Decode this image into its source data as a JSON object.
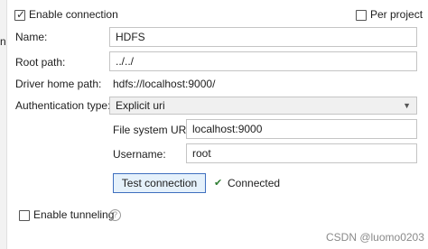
{
  "connection": {
    "enable_connection_label": "Enable connection",
    "per_project_label": "Per project",
    "name_label": "Name:",
    "name_value": "HDFS",
    "root_path_label": "Root path:",
    "root_path_value": "../../",
    "driver_home_label": "Driver home path:",
    "driver_home_value": "hdfs://localhost:9000/",
    "auth_type_label": "Authentication type:",
    "auth_type_value": "Explicit uri",
    "fs_uri_label": "File system URI:",
    "fs_uri_value": "localhost:9000",
    "username_label": "Username:",
    "username_value": "root",
    "test_button_label": "Test connection",
    "status_text": "Connected",
    "enable_tunneling_label": "Enable tunneling",
    "help_glyph": "?"
  },
  "left_fragment": "n",
  "watermark": "CSDN @luomo0203",
  "colors": {
    "success": "#2e7d32",
    "button_border": "#3f6fbf",
    "button_bg": "#e5f1fb"
  }
}
